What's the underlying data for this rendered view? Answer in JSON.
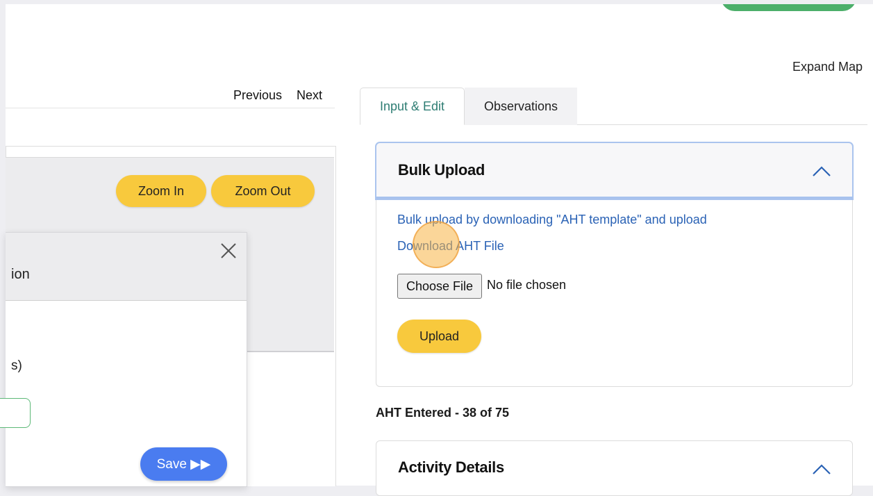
{
  "header": {
    "expand_map_label": "Expand Map"
  },
  "left_pane": {
    "pager": {
      "previous_label": "Previous",
      "next_label": "Next"
    },
    "map_controls": {
      "zoom_in_label": "Zoom In",
      "zoom_out_label": "Zoom Out"
    },
    "modal": {
      "title_fragment": "ion",
      "body_fragment": "s)",
      "save_label": "Save ▶▶"
    }
  },
  "right_pane": {
    "tabs": [
      {
        "label": "Input & Edit",
        "active": true
      },
      {
        "label": "Observations",
        "active": false
      }
    ],
    "bulk_upload": {
      "title": "Bulk Upload",
      "instruction_link": "Bulk upload by downloading \"AHT template\" and upload",
      "download_link": "Download AHT File",
      "choose_file_label": "Choose File",
      "no_file_text": "No file chosen",
      "upload_label": "Upload"
    },
    "aht_status": "AHT Entered - 38 of 75",
    "activity_details": {
      "title": "Activity Details"
    }
  },
  "colors": {
    "accent_yellow": "#f8c93d",
    "save_blue": "#4a7cf0",
    "link_blue": "#2a62b5",
    "active_tab_teal": "#2e7d73",
    "focus_blue": "#a7c2ee",
    "input_green": "#5cb877"
  },
  "icons": {
    "modal_close": "close-icon",
    "collapse": "chevron-up-icon"
  }
}
